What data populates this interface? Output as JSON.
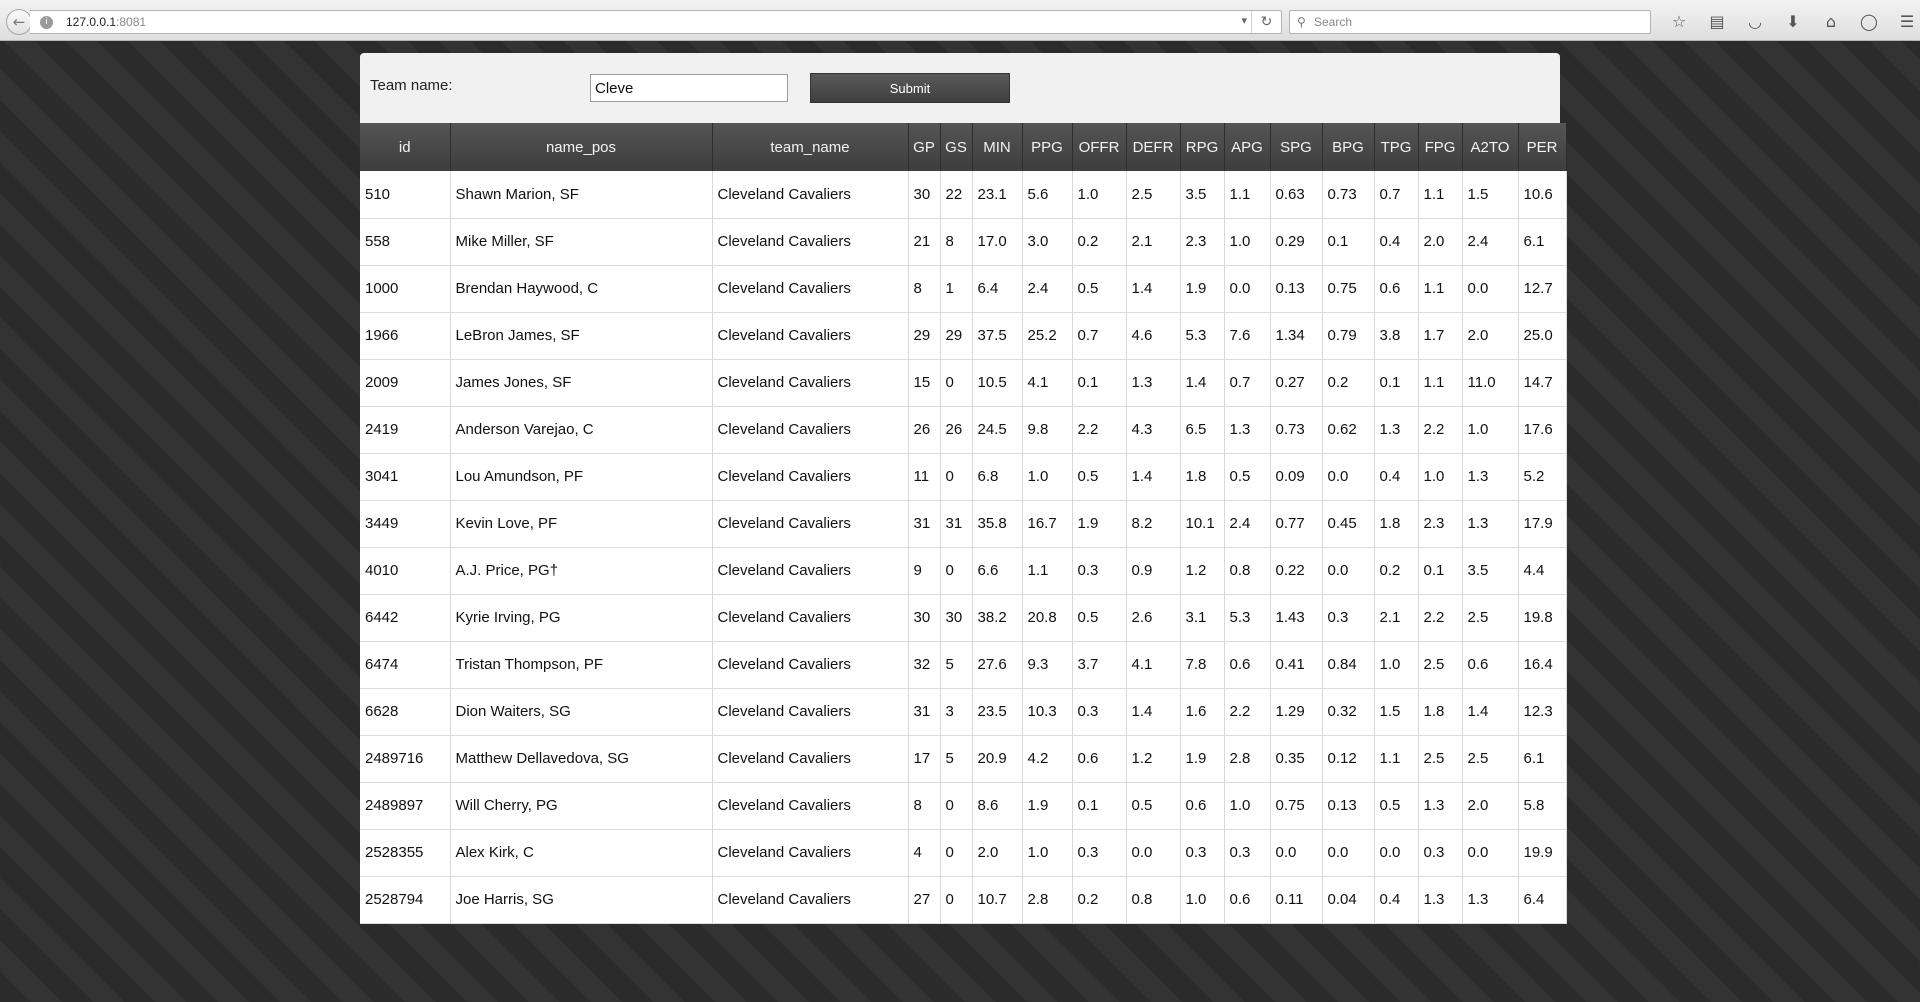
{
  "browser": {
    "url_host": "127.0.0.1",
    "url_port": ":8081",
    "search_placeholder": "Search",
    "icons": [
      "star-icon",
      "reading-list-icon",
      "pocket-icon",
      "download-icon",
      "home-icon",
      "chat-icon",
      "menu-icon"
    ]
  },
  "form": {
    "label": "Team name:",
    "input_value": "Cleve",
    "submit_label": "Submit"
  },
  "table": {
    "columns": [
      "id",
      "name_pos",
      "team_name",
      "GP",
      "GS",
      "MIN",
      "PPG",
      "OFFR",
      "DEFR",
      "RPG",
      "APG",
      "SPG",
      "BPG",
      "TPG",
      "FPG",
      "A2TO",
      "PER"
    ],
    "rows": [
      [
        "510",
        "Shawn Marion, SF",
        "Cleveland Cavaliers",
        "30",
        "22",
        "23.1",
        "5.6",
        "1.0",
        "2.5",
        "3.5",
        "1.1",
        "0.63",
        "0.73",
        "0.7",
        "1.1",
        "1.5",
        "10.6"
      ],
      [
        "558",
        "Mike Miller, SF",
        "Cleveland Cavaliers",
        "21",
        "8",
        "17.0",
        "3.0",
        "0.2",
        "2.1",
        "2.3",
        "1.0",
        "0.29",
        "0.1",
        "0.4",
        "2.0",
        "2.4",
        "6.1"
      ],
      [
        "1000",
        "Brendan Haywood, C",
        "Cleveland Cavaliers",
        "8",
        "1",
        "6.4",
        "2.4",
        "0.5",
        "1.4",
        "1.9",
        "0.0",
        "0.13",
        "0.75",
        "0.6",
        "1.1",
        "0.0",
        "12.7"
      ],
      [
        "1966",
        "LeBron James, SF",
        "Cleveland Cavaliers",
        "29",
        "29",
        "37.5",
        "25.2",
        "0.7",
        "4.6",
        "5.3",
        "7.6",
        "1.34",
        "0.79",
        "3.8",
        "1.7",
        "2.0",
        "25.0"
      ],
      [
        "2009",
        "James Jones, SF",
        "Cleveland Cavaliers",
        "15",
        "0",
        "10.5",
        "4.1",
        "0.1",
        "1.3",
        "1.4",
        "0.7",
        "0.27",
        "0.2",
        "0.1",
        "1.1",
        "11.0",
        "14.7"
      ],
      [
        "2419",
        "Anderson Varejao, C",
        "Cleveland Cavaliers",
        "26",
        "26",
        "24.5",
        "9.8",
        "2.2",
        "4.3",
        "6.5",
        "1.3",
        "0.73",
        "0.62",
        "1.3",
        "2.2",
        "1.0",
        "17.6"
      ],
      [
        "3041",
        "Lou Amundson, PF",
        "Cleveland Cavaliers",
        "11",
        "0",
        "6.8",
        "1.0",
        "0.5",
        "1.4",
        "1.8",
        "0.5",
        "0.09",
        "0.0",
        "0.4",
        "1.0",
        "1.3",
        "5.2"
      ],
      [
        "3449",
        "Kevin Love, PF",
        "Cleveland Cavaliers",
        "31",
        "31",
        "35.8",
        "16.7",
        "1.9",
        "8.2",
        "10.1",
        "2.4",
        "0.77",
        "0.45",
        "1.8",
        "2.3",
        "1.3",
        "17.9"
      ],
      [
        "4010",
        "A.J. Price, PG†",
        "Cleveland Cavaliers",
        "9",
        "0",
        "6.6",
        "1.1",
        "0.3",
        "0.9",
        "1.2",
        "0.8",
        "0.22",
        "0.0",
        "0.2",
        "0.1",
        "3.5",
        "4.4"
      ],
      [
        "6442",
        "Kyrie Irving, PG",
        "Cleveland Cavaliers",
        "30",
        "30",
        "38.2",
        "20.8",
        "0.5",
        "2.6",
        "3.1",
        "5.3",
        "1.43",
        "0.3",
        "2.1",
        "2.2",
        "2.5",
        "19.8"
      ],
      [
        "6474",
        "Tristan Thompson, PF",
        "Cleveland Cavaliers",
        "32",
        "5",
        "27.6",
        "9.3",
        "3.7",
        "4.1",
        "7.8",
        "0.6",
        "0.41",
        "0.84",
        "1.0",
        "2.5",
        "0.6",
        "16.4"
      ],
      [
        "6628",
        "Dion Waiters, SG",
        "Cleveland Cavaliers",
        "31",
        "3",
        "23.5",
        "10.3",
        "0.3",
        "1.4",
        "1.6",
        "2.2",
        "1.29",
        "0.32",
        "1.5",
        "1.8",
        "1.4",
        "12.3"
      ],
      [
        "2489716",
        "Matthew Dellavedova, SG",
        "Cleveland Cavaliers",
        "17",
        "5",
        "20.9",
        "4.2",
        "0.6",
        "1.2",
        "1.9",
        "2.8",
        "0.35",
        "0.12",
        "1.1",
        "2.5",
        "2.5",
        "6.1"
      ],
      [
        "2489897",
        "Will Cherry, PG",
        "Cleveland Cavaliers",
        "8",
        "0",
        "8.6",
        "1.9",
        "0.1",
        "0.5",
        "0.6",
        "1.0",
        "0.75",
        "0.13",
        "0.5",
        "1.3",
        "2.0",
        "5.8"
      ],
      [
        "2528355",
        "Alex Kirk, C",
        "Cleveland Cavaliers",
        "4",
        "0",
        "2.0",
        "1.0",
        "0.3",
        "0.0",
        "0.3",
        "0.3",
        "0.0",
        "0.0",
        "0.0",
        "0.3",
        "0.0",
        "19.9"
      ],
      [
        "2528794",
        "Joe Harris, SG",
        "Cleveland Cavaliers",
        "27",
        "0",
        "10.7",
        "2.8",
        "0.2",
        "0.8",
        "1.0",
        "0.6",
        "0.11",
        "0.04",
        "0.4",
        "1.3",
        "1.3",
        "6.4"
      ]
    ]
  }
}
